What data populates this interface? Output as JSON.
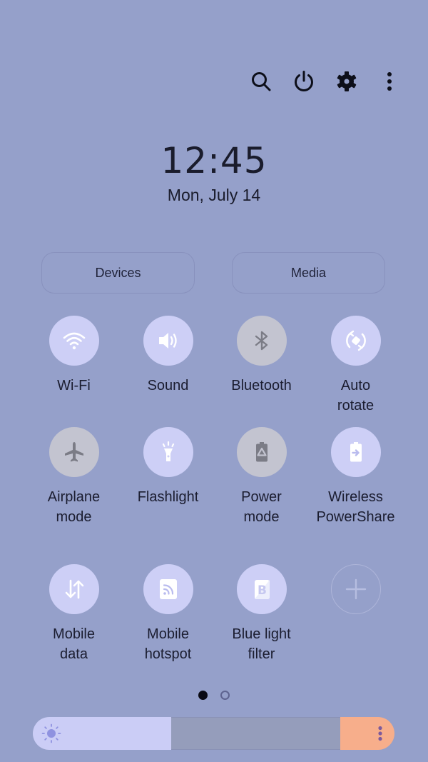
{
  "colors": {
    "background": "#95a0ca",
    "tile_on": "#cdcff6",
    "tile_off": "#c3c4d0",
    "brightness_fill": "#cbcdf6",
    "brightness_more": "#f7ae8b"
  },
  "top_actions": [
    {
      "name": "search",
      "icon": "search-icon"
    },
    {
      "name": "power",
      "icon": "power-icon"
    },
    {
      "name": "settings",
      "icon": "gear-icon"
    },
    {
      "name": "more",
      "icon": "more-vertical-icon"
    }
  ],
  "clock": {
    "time": "12:45",
    "date": "Mon, July 14"
  },
  "pills": {
    "devices": "Devices",
    "media": "Media"
  },
  "tiles": [
    {
      "label": "Wi-Fi",
      "icon": "wifi-icon",
      "state": "on"
    },
    {
      "label": "Sound",
      "icon": "sound-icon",
      "state": "on"
    },
    {
      "label": "Bluetooth",
      "icon": "bluetooth-icon",
      "state": "off"
    },
    {
      "label": "Auto\nrotate",
      "icon": "auto-rotate-icon",
      "state": "on"
    },
    {
      "label": "Airplane\nmode",
      "icon": "airplane-icon",
      "state": "off"
    },
    {
      "label": "Flashlight",
      "icon": "flashlight-icon",
      "state": "on"
    },
    {
      "label": "Power\nmode",
      "icon": "power-mode-icon",
      "state": "off"
    },
    {
      "label": "Wireless\nPowerShare",
      "icon": "wireless-powershare-icon",
      "state": "on"
    },
    {
      "label": "Mobile\ndata",
      "icon": "mobile-data-icon",
      "state": "on"
    },
    {
      "label": "Mobile\nhotspot",
      "icon": "mobile-hotspot-icon",
      "state": "on"
    },
    {
      "label": "Blue light\nfilter",
      "icon": "blue-light-filter-icon",
      "state": "on"
    },
    {
      "label": "",
      "icon": "add-icon",
      "state": "add"
    }
  ],
  "pager": {
    "current_page": 1,
    "total_pages": 2
  },
  "brightness": {
    "level_percent": 45
  }
}
